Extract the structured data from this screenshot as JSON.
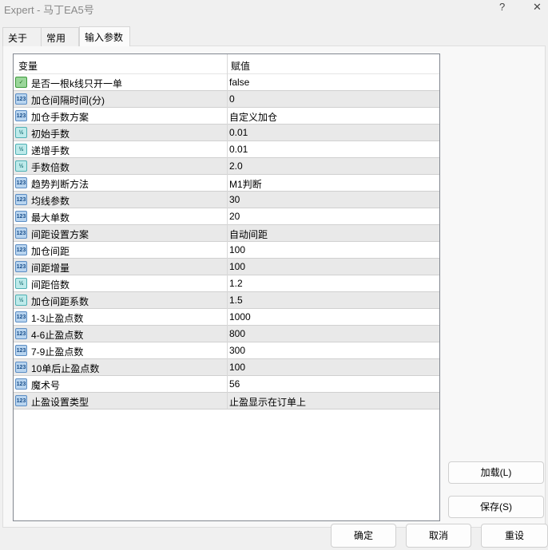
{
  "window": {
    "title": "Expert - 马丁EA5号",
    "help": "?",
    "close": "✕"
  },
  "tabs": [
    {
      "label": "关于"
    },
    {
      "label": "常用"
    },
    {
      "label": "输入参数"
    }
  ],
  "table": {
    "headers": {
      "variable": "变量",
      "value": "赋值"
    },
    "rows": [
      {
        "type": "bool",
        "icon": "bool-icon",
        "name": "是否一根k线只开一单",
        "value": "false"
      },
      {
        "type": "int",
        "icon": "int-icon",
        "name": "加仓间隔时间(分)",
        "value": "0"
      },
      {
        "type": "int",
        "icon": "int-icon",
        "name": "加仓手数方案",
        "value": "自定义加仓"
      },
      {
        "type": "dbl",
        "icon": "double-icon",
        "name": "初始手数",
        "value": "0.01"
      },
      {
        "type": "dbl",
        "icon": "double-icon",
        "name": "递增手数",
        "value": "0.01"
      },
      {
        "type": "dbl",
        "icon": "double-icon",
        "name": "手数倍数",
        "value": "2.0"
      },
      {
        "type": "int",
        "icon": "int-icon",
        "name": "趋势判断方法",
        "value": "M1判断"
      },
      {
        "type": "int",
        "icon": "int-icon",
        "name": "均线参数",
        "value": "30"
      },
      {
        "type": "int",
        "icon": "int-icon",
        "name": "最大单数",
        "value": "20"
      },
      {
        "type": "int",
        "icon": "int-icon",
        "name": "间距设置方案",
        "value": "自动间距"
      },
      {
        "type": "int",
        "icon": "int-icon",
        "name": "加仓间距",
        "value": "100"
      },
      {
        "type": "int",
        "icon": "int-icon",
        "name": "间距增量",
        "value": "100"
      },
      {
        "type": "dbl",
        "icon": "double-icon",
        "name": "间距倍数",
        "value": "1.2"
      },
      {
        "type": "dbl",
        "icon": "double-icon",
        "name": "加仓间距系数",
        "value": "1.5"
      },
      {
        "type": "int",
        "icon": "int-icon",
        "name": "1-3止盈点数",
        "value": "1000"
      },
      {
        "type": "int",
        "icon": "int-icon",
        "name": "4-6止盈点数",
        "value": "800"
      },
      {
        "type": "int",
        "icon": "int-icon",
        "name": "7-9止盈点数",
        "value": "300"
      },
      {
        "type": "int",
        "icon": "int-icon",
        "name": "10单后止盈点数",
        "value": "100"
      },
      {
        "type": "int",
        "icon": "int-icon",
        "name": "魔术号",
        "value": "56"
      },
      {
        "type": "int",
        "icon": "int-icon",
        "name": "止盈设置类型",
        "value": "止盈显示在订单上"
      }
    ]
  },
  "buttons": {
    "load": "加载(L)",
    "save": "保存(S)",
    "ok": "确定",
    "cancel": "取消",
    "reset": "重设"
  }
}
